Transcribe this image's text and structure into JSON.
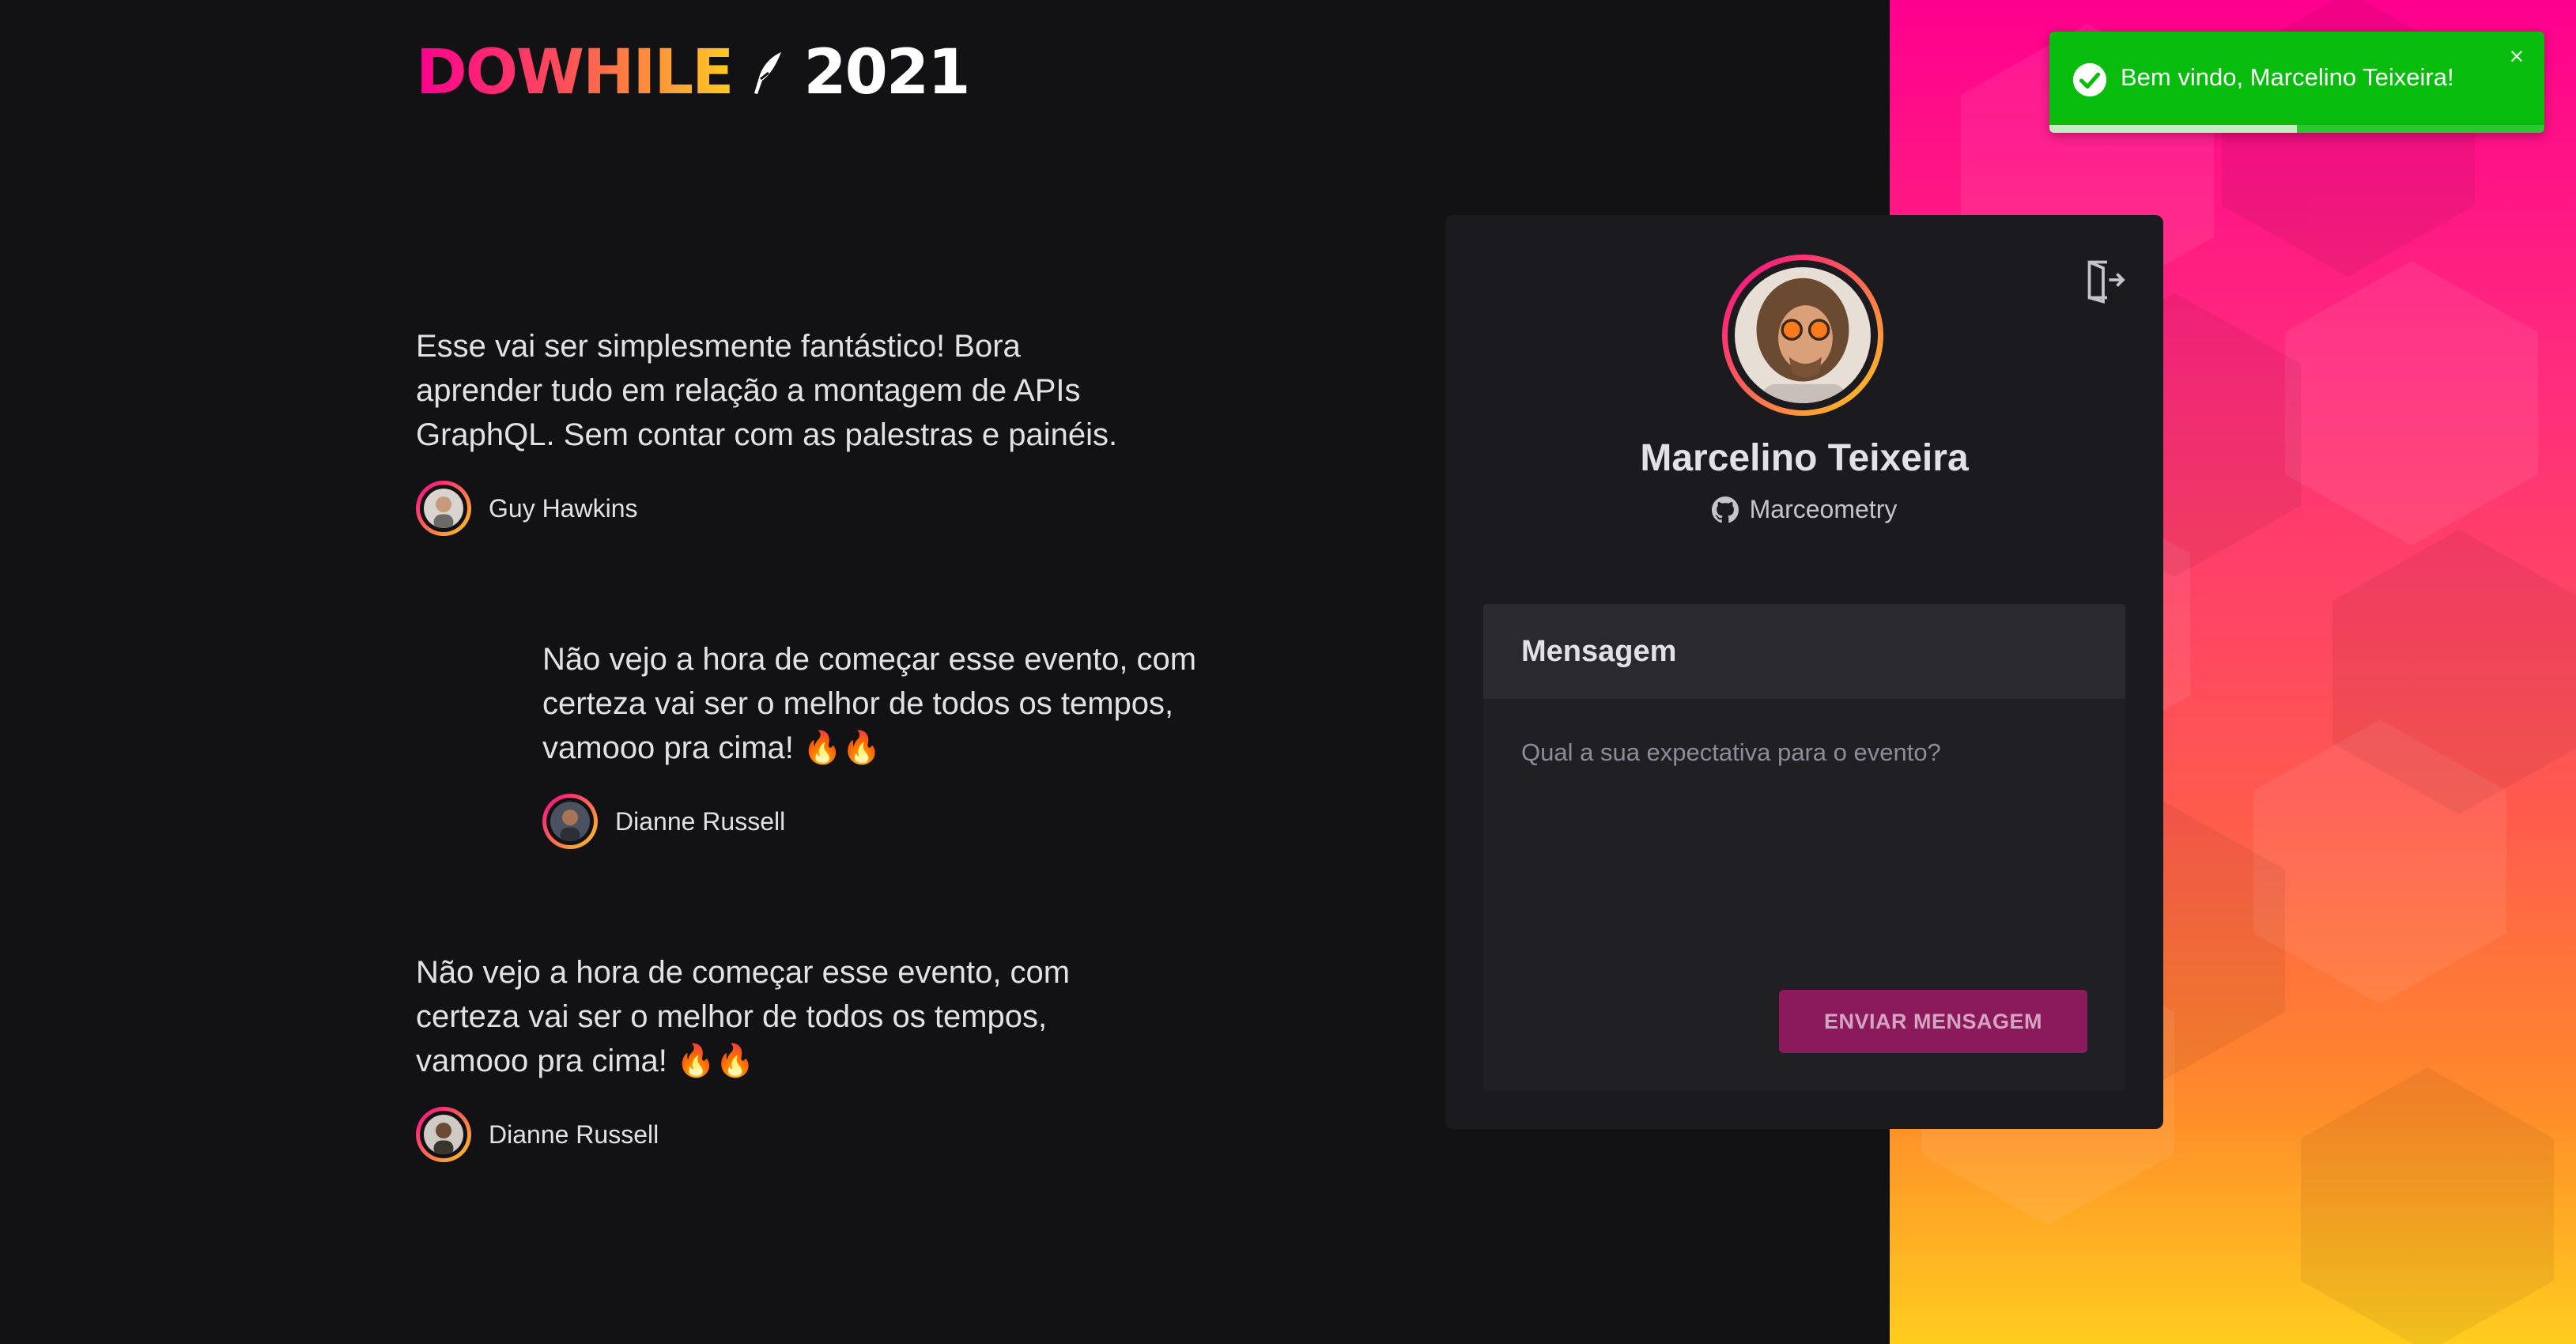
{
  "logo": {
    "word": "DOWHILE",
    "year": "2021"
  },
  "messages": [
    {
      "text": "Esse vai ser simplesmente fantástico! Bora aprender tudo em relação a montagem de APIs GraphQL. Sem contar com as palestras e painéis.",
      "author": "Guy Hawkins"
    },
    {
      "text": "Não vejo a hora de começar esse evento, com certeza vai ser o melhor de todos os tempos, vamooo pra cima! 🔥🔥",
      "author": "Dianne Russell"
    },
    {
      "text": "Não vejo a hora de começar esse evento, com certeza vai ser o melhor de todos os tempos, vamooo pra cima! 🔥🔥",
      "author": "Dianne Russell"
    }
  ],
  "user": {
    "name": "Marcelino Teixeira",
    "github_login": "Marceometry"
  },
  "form": {
    "title": "Mensagem",
    "placeholder": "Qual a sua expectativa para o evento?",
    "submit_label": "ENVIAR MENSAGEM"
  },
  "toast": {
    "text": "Bem vindo, Marcelino Teixeira!",
    "close_icon": "×",
    "progress": 0.5
  },
  "colors": {
    "background": "#121214",
    "card": "#1b1b1f",
    "accent_pink": "#ff008e",
    "accent_yellow": "#ffcd1e",
    "button": "#8a1a5c",
    "toast": "#07bc0c"
  },
  "icons": {
    "signout": "sign-out-icon",
    "github": "github-icon",
    "toast_check": "check-circle-icon",
    "toast_close": "close-icon"
  }
}
